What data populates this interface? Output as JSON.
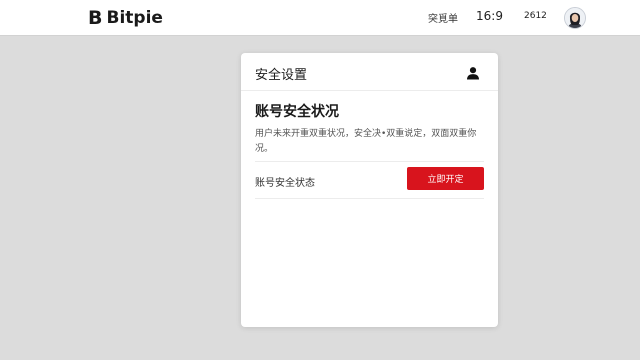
{
  "header": {
    "brand_mark": "B",
    "brand_name": "Bitpie",
    "nav_link": "突覓单",
    "ratio": "16:9",
    "count": "2612"
  },
  "card": {
    "title": "安全设置",
    "section_title": "账号安全状况",
    "description": "用户未来开重双重状况，安全决•双重说定，双面双重你况。",
    "status_label": "账号安全状态",
    "enable_button": "立即开定"
  },
  "colors": {
    "accent": "#d8141d",
    "page_background": "#dcdcdc",
    "card_background": "#ffffff"
  },
  "icons": {
    "brand": "bitpie-logo-icon",
    "avatar": "user-avatar",
    "account": "user-icon"
  }
}
